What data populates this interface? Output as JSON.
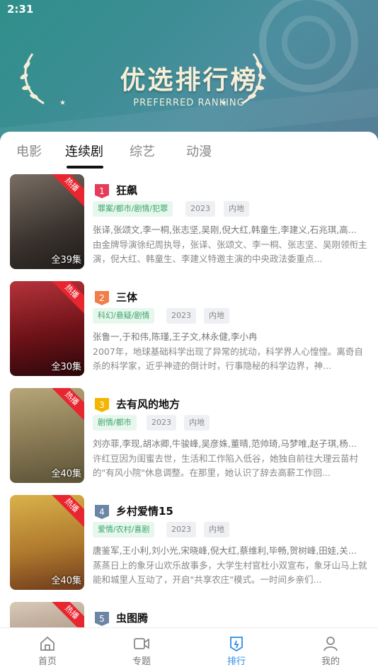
{
  "status": {
    "time": "2:31"
  },
  "hero": {
    "title": "优选排行榜",
    "subtitle": "PREFERRED RANKING"
  },
  "tabs": [
    "电影",
    "连续剧",
    "综艺",
    "动漫"
  ],
  "items": [
    {
      "rank": "1",
      "rank_color": "#e63c5a",
      "title": "狂飙",
      "genre": "罪案/都市/剧情/犯罪",
      "year": "2023",
      "region": "内地",
      "cast": "张译,张颂文,李一桐,张志坚,吴刚,倪大红,韩童生,李建义,石兆琪,高...",
      "desc": "由金牌导演徐纪周执导，张译、张颂文、李一桐、张志坚、吴刚领衔主演，倪大红、韩童生、李建义特邀主演的中央政法委重点...",
      "badge": "热播",
      "episodes": "全39集"
    },
    {
      "rank": "2",
      "rank_color": "#f07d4a",
      "title": "三体",
      "genre": "科幻/悬疑/剧情",
      "year": "2023",
      "region": "内地",
      "cast": "张鲁一,于和伟,陈瑾,王子文,林永健,李小冉",
      "desc": "2007年，地球基础科学出现了异常的扰动，科学界人心惶惶。离奇自杀的科学家，近乎神迹的倒计时，行事隐秘的科学边界，神...",
      "badge": "热播",
      "episodes": "全30集"
    },
    {
      "rank": "3",
      "rank_color": "#f4b400",
      "title": "去有风的地方",
      "genre": "剧情/都市",
      "year": "2023",
      "region": "内地",
      "cast": "刘亦菲,李现,胡冰卿,牛骏峰,吴彦姝,董晴,范帅琦,马梦唯,赵子琪,杨...",
      "desc": "许红豆因为闺蜜去世，生活和工作陷入低谷，她独自前往大理云苗村的\"有风小院\"休息调整。在那里，她认识了辞去高薪工作回...",
      "badge": "热播",
      "episodes": "全40集"
    },
    {
      "rank": "4",
      "rank_color": "#6b86a5",
      "title": "乡村爱情15",
      "genre": "爱情/农村/喜剧",
      "year": "2023",
      "region": "内地",
      "cast": "唐鉴军,王小利,刘小光,宋晓峰,倪大红,蔡维利,毕畅,贺树峰,田娃,关...",
      "desc": "蒸蒸日上的象牙山欢乐故事多，大学生村官杜小双宣布，象牙山马上就能和城里人互动了，开启\"共享农庄\"模式。一时间乡亲们...",
      "badge": "热播",
      "episodes": "全40集"
    },
    {
      "rank": "5",
      "rank_color": "#6b86a5",
      "title": "虫图腾",
      "genre": "",
      "year": "",
      "region": "",
      "cast": "",
      "desc": "",
      "badge": "热播",
      "episodes": ""
    }
  ],
  "nav": [
    {
      "label": "首页",
      "icon": "home-icon"
    },
    {
      "label": "专题",
      "icon": "video-icon"
    },
    {
      "label": "排行",
      "icon": "ranking-icon",
      "active": true
    },
    {
      "label": "我的",
      "icon": "user-icon"
    }
  ],
  "colors": {
    "accent": "#2f8be6",
    "hero": "#3c8e94",
    "hot": "#e8262f",
    "genre_tag": "#3aa56b"
  }
}
